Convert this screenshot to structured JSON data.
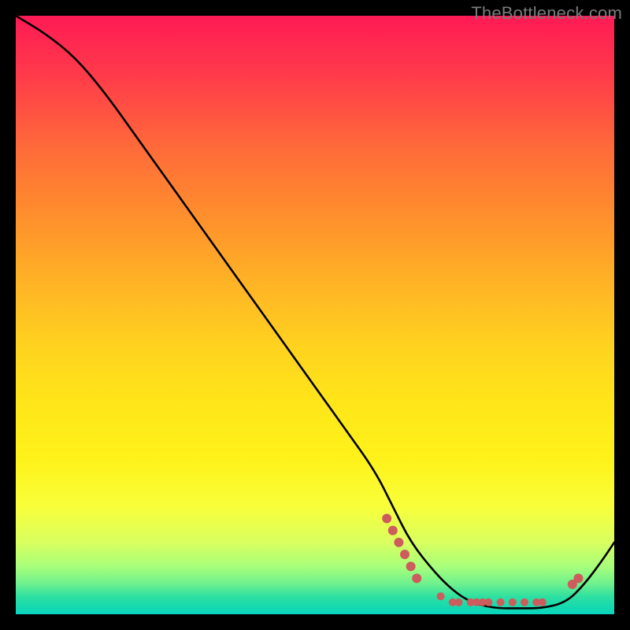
{
  "watermark": "TheBottleneck.com",
  "chart_data": {
    "type": "line",
    "title": "",
    "xlabel": "",
    "ylabel": "",
    "xlim": [
      0,
      100
    ],
    "ylim": [
      0,
      100
    ],
    "grid": false,
    "series": [
      {
        "name": "curve",
        "x": [
          0,
          5,
          10,
          15,
          20,
          25,
          30,
          35,
          40,
          45,
          50,
          55,
          60,
          63,
          66,
          70,
          73,
          76,
          80,
          84,
          88,
          92,
          95,
          98,
          100
        ],
        "y": [
          100,
          97,
          93,
          87,
          80,
          73,
          66,
          59,
          52,
          45,
          38,
          31,
          24,
          18,
          12,
          7,
          4,
          2,
          1,
          1,
          1,
          2,
          5,
          9,
          12
        ],
        "color": "#000000"
      }
    ],
    "markers": [
      {
        "x": 62,
        "y": 16,
        "r": 6,
        "color": "#cd5c5c"
      },
      {
        "x": 63,
        "y": 14,
        "r": 6,
        "color": "#cd5c5c"
      },
      {
        "x": 64,
        "y": 12,
        "r": 6,
        "color": "#cd5c5c"
      },
      {
        "x": 65,
        "y": 10,
        "r": 6,
        "color": "#cd5c5c"
      },
      {
        "x": 66,
        "y": 8,
        "r": 6,
        "color": "#cd5c5c"
      },
      {
        "x": 67,
        "y": 6,
        "r": 6,
        "color": "#cd5c5c"
      },
      {
        "x": 71,
        "y": 3,
        "r": 5,
        "color": "#cd5c5c"
      },
      {
        "x": 73,
        "y": 2,
        "r": 5,
        "color": "#cd5c5c"
      },
      {
        "x": 74,
        "y": 2,
        "r": 5,
        "color": "#cd5c5c"
      },
      {
        "x": 76,
        "y": 2,
        "r": 5,
        "color": "#cd5c5c"
      },
      {
        "x": 77,
        "y": 2,
        "r": 5,
        "color": "#cd5c5c"
      },
      {
        "x": 78,
        "y": 2,
        "r": 5,
        "color": "#cd5c5c"
      },
      {
        "x": 79,
        "y": 2,
        "r": 5,
        "color": "#cd5c5c"
      },
      {
        "x": 81,
        "y": 2,
        "r": 5,
        "color": "#cd5c5c"
      },
      {
        "x": 83,
        "y": 2,
        "r": 5,
        "color": "#cd5c5c"
      },
      {
        "x": 85,
        "y": 2,
        "r": 5,
        "color": "#cd5c5c"
      },
      {
        "x": 87,
        "y": 2,
        "r": 5,
        "color": "#cd5c5c"
      },
      {
        "x": 88,
        "y": 2,
        "r": 5,
        "color": "#cd5c5c"
      },
      {
        "x": 93,
        "y": 5,
        "r": 6,
        "color": "#cd5c5c"
      },
      {
        "x": 94,
        "y": 6,
        "r": 6,
        "color": "#cd5c5c"
      }
    ]
  }
}
